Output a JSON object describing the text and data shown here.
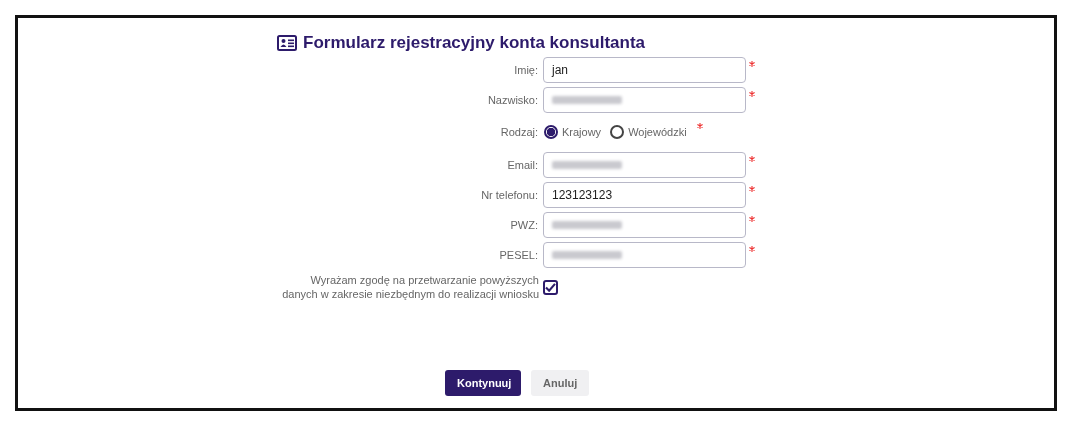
{
  "title": "Formularz rejestracyjny konta konsultanta",
  "fields": [
    {
      "kind": "text",
      "label": "Imię:",
      "value": "jan",
      "required": true
    },
    {
      "kind": "text",
      "label": "Nazwisko:",
      "redacted": true,
      "required": true
    },
    {
      "kind": "radio",
      "label": "Rodzaj:",
      "required": true,
      "options": [
        {
          "label": "Krajowy",
          "selected": true
        },
        {
          "label": "Wojewódzki",
          "selected": false
        }
      ]
    },
    {
      "kind": "text",
      "label": "Email:",
      "redacted": true,
      "required": true
    },
    {
      "kind": "text",
      "label": "Nr telefonu:",
      "value": "123123123",
      "required": true
    },
    {
      "kind": "text",
      "label": "PWZ:",
      "redacted": true,
      "required": true
    },
    {
      "kind": "text",
      "label": "PESEL:",
      "redacted": true,
      "required": true
    },
    {
      "kind": "checkbox",
      "label": "Wyrażam zgodę na przetwarzanie powyższych danych w zakresie niezbędnym do realizacji wniosku",
      "checked": true
    }
  ],
  "buttons": [
    {
      "label": "Kontynuuj",
      "kind": "primary"
    },
    {
      "label": "Anuluj",
      "kind": "secondary"
    }
  ]
}
